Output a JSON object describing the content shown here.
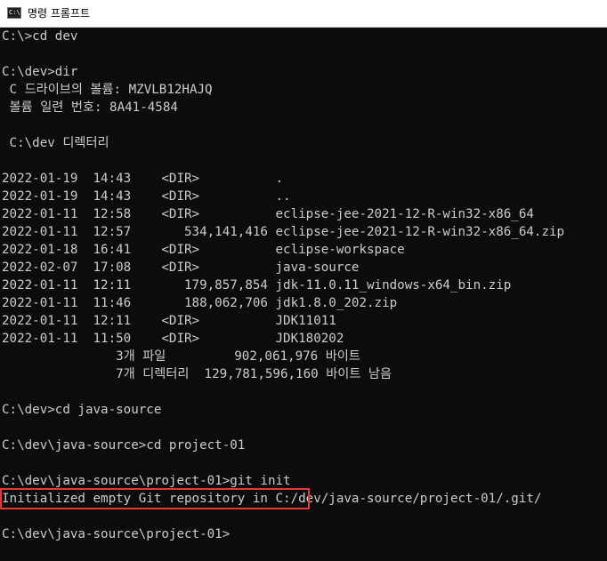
{
  "window": {
    "title": "명령 프롬프트",
    "icon_text": "C:\\",
    "icon_name": "cmd-icon"
  },
  "console": {
    "lines": [
      "C:\\>cd dev",
      "",
      "C:\\dev>dir",
      " C 드라이브의 볼륨: MZVLB12HAJQ",
      " 볼륨 일련 번호: 8A41-4584",
      "",
      " C:\\dev 디렉터리",
      "",
      "2022-01-19  14:43    <DIR>          .",
      "2022-01-19  14:43    <DIR>          ..",
      "2022-01-11  12:58    <DIR>          eclipse-jee-2021-12-R-win32-x86_64",
      "2022-01-11  12:57       534,141,416 eclipse-jee-2021-12-R-win32-x86_64.zip",
      "2022-01-18  16:41    <DIR>          eclipse-workspace",
      "2022-02-07  17:08    <DIR>          java-source",
      "2022-01-11  12:11       179,857,854 jdk-11.0.11_windows-x64_bin.zip",
      "2022-01-11  11:46       188,062,706 jdk1.8.0_202.zip",
      "2022-01-11  12:11    <DIR>          JDK11011",
      "2022-01-11  11:50    <DIR>          JDK180202",
      "               3개 파일         902,061,976 바이트",
      "               7개 디렉터리  129,781,596,160 바이트 남음",
      "",
      "C:\\dev>cd java-source",
      "",
      "C:\\dev\\java-source>cd project-01",
      "",
      "C:\\dev\\java-source\\project-01>git init",
      "Initialized empty Git repository in C:/dev/java-source/project-01/.git/",
      "",
      "C:\\dev\\java-source\\project-01>"
    ]
  },
  "colors": {
    "console_bg": "#0c0c0c",
    "console_fg": "#cccccc",
    "highlight_border": "#e53935",
    "titlebar_bg": "#ffffff"
  }
}
